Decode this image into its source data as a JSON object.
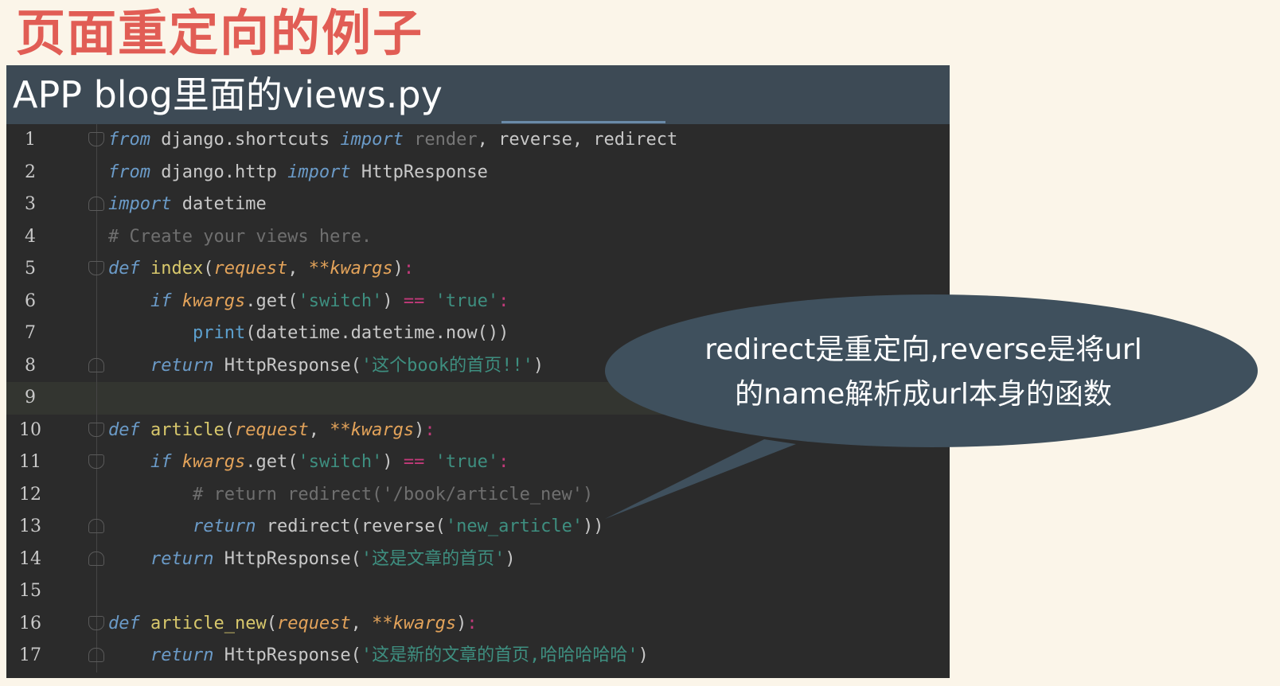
{
  "slide": {
    "title": "页面重定向的例子"
  },
  "editor": {
    "header_title": "APP blog里面的views.py"
  },
  "code_lines": [
    {
      "n": "1",
      "segments": [
        [
          "kw",
          "from"
        ],
        [
          "t",
          " django.shortcuts "
        ],
        [
          "kw",
          "import"
        ],
        [
          "dim",
          " render"
        ],
        [
          "t",
          ", reverse, redirect"
        ]
      ]
    },
    {
      "n": "2",
      "segments": [
        [
          "kw",
          "from"
        ],
        [
          "t",
          " django.http "
        ],
        [
          "kw",
          "import"
        ],
        [
          "t",
          " HttpResponse"
        ]
      ]
    },
    {
      "n": "3",
      "segments": [
        [
          "kw",
          "import"
        ],
        [
          "t",
          " datetime"
        ]
      ]
    },
    {
      "n": "4",
      "segments": [
        [
          "cm",
          "# Create your views here."
        ]
      ]
    },
    {
      "n": "5",
      "segments": [
        [
          "kw",
          "def"
        ],
        [
          "t",
          " "
        ],
        [
          "fn",
          "index"
        ],
        [
          "t",
          "("
        ],
        [
          "param",
          "request"
        ],
        [
          "t",
          ", "
        ],
        [
          "param",
          "**kwargs"
        ],
        [
          "t",
          ")"
        ],
        [
          "op",
          ":"
        ]
      ]
    },
    {
      "n": "6",
      "segments": [
        [
          "t",
          "    "
        ],
        [
          "kw",
          "if"
        ],
        [
          "t",
          " "
        ],
        [
          "param",
          "kwargs"
        ],
        [
          "t",
          ".get("
        ],
        [
          "str",
          "'switch'"
        ],
        [
          "t",
          ") "
        ],
        [
          "op",
          "=="
        ],
        [
          "t",
          " "
        ],
        [
          "str",
          "'true'"
        ],
        [
          "op",
          ":"
        ]
      ]
    },
    {
      "n": "7",
      "segments": [
        [
          "t",
          "        "
        ],
        [
          "bi",
          "print"
        ],
        [
          "t",
          "(datetime.datetime.now())"
        ]
      ]
    },
    {
      "n": "8",
      "segments": [
        [
          "t",
          "    "
        ],
        [
          "kw",
          "return"
        ],
        [
          "t",
          " HttpResponse("
        ],
        [
          "str",
          "'这个book的首页!!'"
        ],
        [
          "t",
          ")"
        ]
      ]
    },
    {
      "n": "9",
      "segments": []
    },
    {
      "n": "10",
      "segments": [
        [
          "kw",
          "def"
        ],
        [
          "t",
          " "
        ],
        [
          "fn",
          "article"
        ],
        [
          "t",
          "("
        ],
        [
          "param",
          "request"
        ],
        [
          "t",
          ", "
        ],
        [
          "param",
          "**kwargs"
        ],
        [
          "t",
          ")"
        ],
        [
          "op",
          ":"
        ]
      ]
    },
    {
      "n": "11",
      "segments": [
        [
          "t",
          "    "
        ],
        [
          "kw",
          "if"
        ],
        [
          "t",
          " "
        ],
        [
          "param",
          "kwargs"
        ],
        [
          "t",
          ".get("
        ],
        [
          "str",
          "'switch'"
        ],
        [
          "t",
          ") "
        ],
        [
          "op",
          "=="
        ],
        [
          "t",
          " "
        ],
        [
          "str",
          "'true'"
        ],
        [
          "op",
          ":"
        ]
      ]
    },
    {
      "n": "12",
      "segments": [
        [
          "t",
          "        "
        ],
        [
          "cm",
          "# return redirect('/book/article_new')"
        ]
      ]
    },
    {
      "n": "13",
      "segments": [
        [
          "t",
          "        "
        ],
        [
          "kw",
          "return"
        ],
        [
          "t",
          " redirect(reverse("
        ],
        [
          "str",
          "'new_article'"
        ],
        [
          "t",
          "))"
        ]
      ]
    },
    {
      "n": "14",
      "segments": [
        [
          "t",
          "    "
        ],
        [
          "kw",
          "return"
        ],
        [
          "t",
          " HttpResponse("
        ],
        [
          "str",
          "'这是文章的首页'"
        ],
        [
          "t",
          ")"
        ]
      ]
    },
    {
      "n": "15",
      "segments": []
    },
    {
      "n": "16",
      "segments": [
        [
          "kw",
          "def"
        ],
        [
          "t",
          " "
        ],
        [
          "fn",
          "article_new"
        ],
        [
          "t",
          "("
        ],
        [
          "param",
          "request"
        ],
        [
          "t",
          ", "
        ],
        [
          "param",
          "**kwargs"
        ],
        [
          "t",
          ")"
        ],
        [
          "op",
          ":"
        ]
      ]
    },
    {
      "n": "17",
      "segments": [
        [
          "t",
          "    "
        ],
        [
          "kw",
          "return"
        ],
        [
          "t",
          " HttpResponse("
        ],
        [
          "str",
          "'这是新的文章的首页,哈哈哈哈哈'"
        ],
        [
          "t",
          ")"
        ]
      ]
    }
  ],
  "callout": {
    "line1": "redirect是重定向,reverse是将url",
    "line2": "的name解析成url本身的函数"
  },
  "colors": {
    "title": "#e15d55",
    "background": "#fbf5e9",
    "editor_bg": "#2b2b2b",
    "header_bg": "#3d4a55",
    "callout_bg": "#3f505d"
  }
}
